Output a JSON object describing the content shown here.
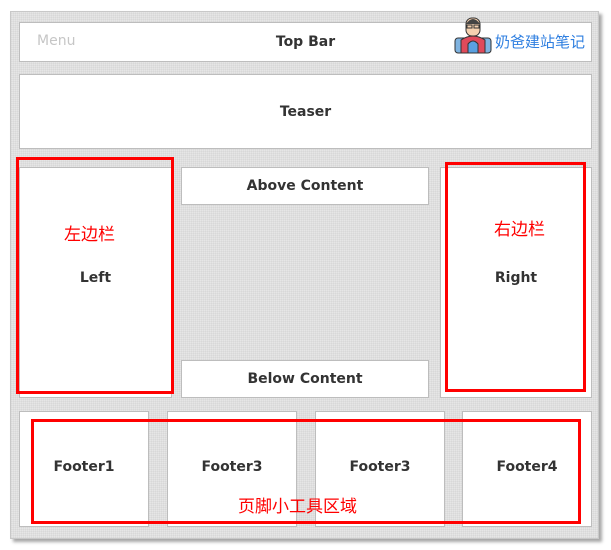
{
  "top_bar": {
    "menu": "Menu",
    "title": "Top Bar"
  },
  "watermark": {
    "text": "奶爸建站笔记",
    "icon": "avatar-icon"
  },
  "teaser": "Teaser",
  "left": {
    "label": "Left",
    "annotation": "左边栏"
  },
  "right": {
    "label": "Right",
    "annotation": "右边栏"
  },
  "content": {
    "above": "Above Content",
    "below": "Below Content"
  },
  "footers": [
    "Footer1",
    "Footer3",
    "Footer3",
    "Footer4"
  ],
  "footer_annotation": "页脚小工具区域",
  "colors": {
    "annotation": "#ff0000",
    "watermark": "#2f7fe0"
  }
}
